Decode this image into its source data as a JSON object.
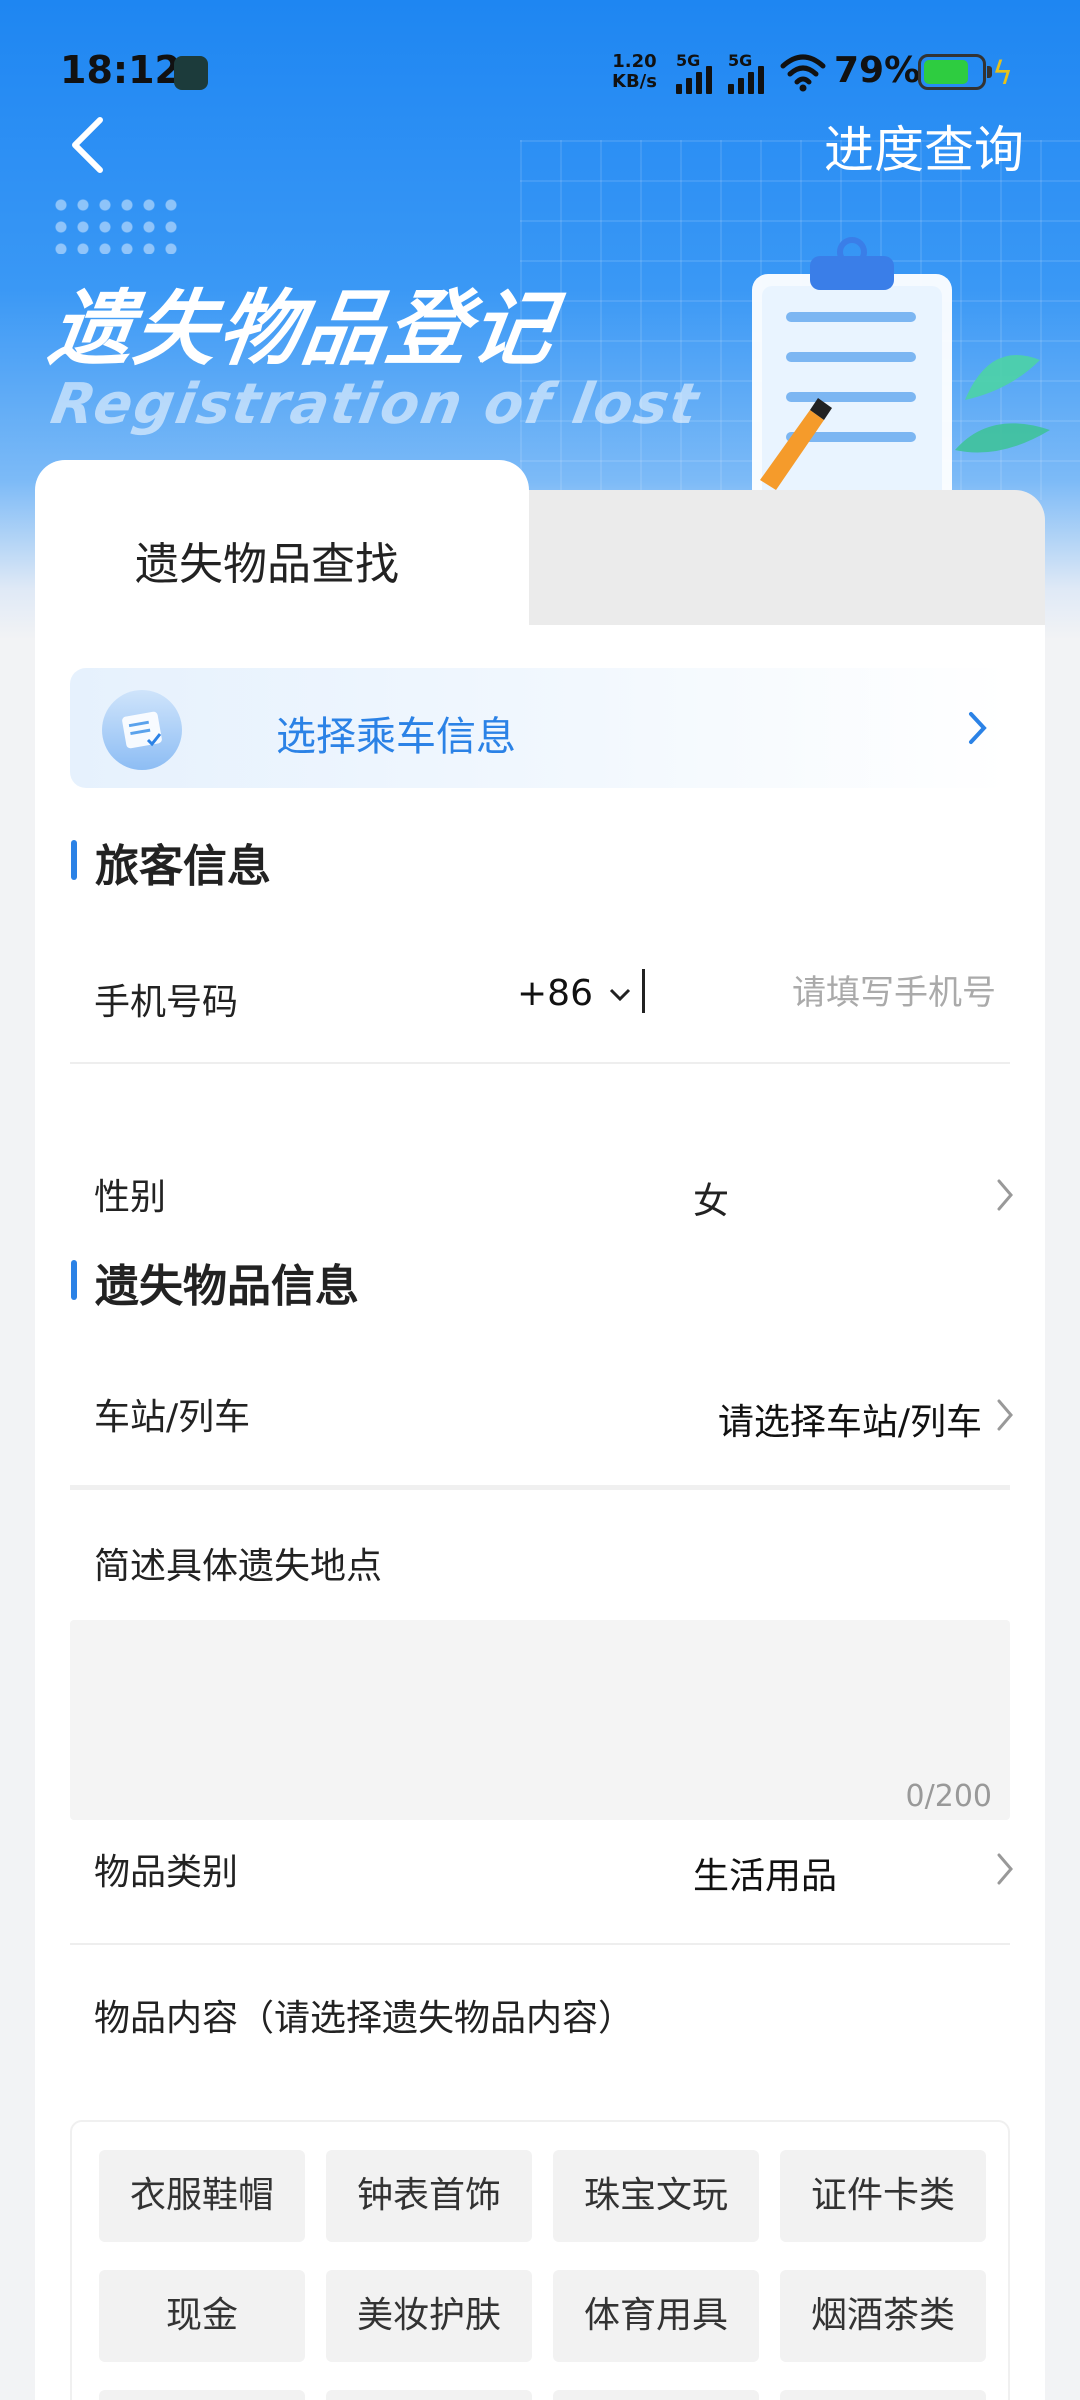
{
  "status_bar": {
    "time": "18:12",
    "net_speed_value": "1.20",
    "net_speed_unit": "KB/s",
    "sim1": "5G",
    "sim2": "5G",
    "battery": "79%"
  },
  "header": {
    "progress_query": "进度查询",
    "title_cn": "遗失物品登记",
    "title_en": "Registration of lost"
  },
  "tabs": [
    {
      "label": "遗失物品查找",
      "active": true
    },
    {
      "label": "",
      "active": false
    }
  ],
  "trip_info": {
    "label": "选择乘车信息"
  },
  "passenger_section": {
    "title": "旅客信息",
    "phone_label": "手机号码",
    "country_code": "+86",
    "phone_placeholder": "请填写手机号",
    "gender_label": "性别",
    "gender_value": "女"
  },
  "lost_section": {
    "title": "遗失物品信息",
    "station_label": "车站/列车",
    "station_value": "请选择车站/列车",
    "location_label": "简述具体遗失地点",
    "location_counter": "0/200",
    "category_label": "物品类别",
    "category_value": "生活用品",
    "content_label": "物品内容（请选择遗失物品内容）"
  },
  "item_chips": [
    "衣服鞋帽",
    "钟表首饰",
    "珠宝文玩",
    "证件卡类",
    "现金",
    "美妆护肤",
    "体育用具",
    "烟酒茶类"
  ],
  "colors": {
    "accent": "#2b82e6",
    "hero_top": "#1e86f2",
    "chip_bg": "#f2f2f2"
  }
}
